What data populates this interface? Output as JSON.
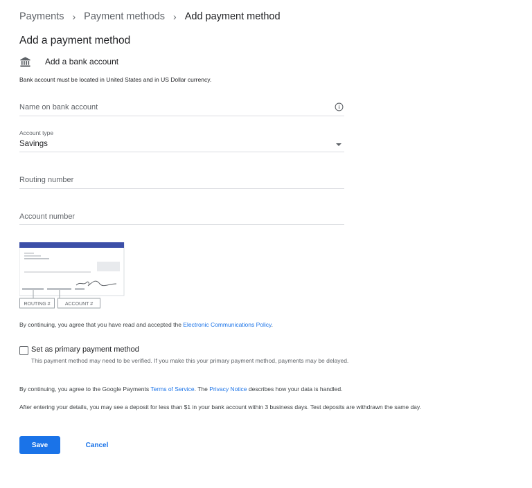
{
  "breadcrumb": {
    "items": [
      "Payments",
      "Payment methods",
      "Add payment method"
    ],
    "separator": "›"
  },
  "page_title": "Add a payment method",
  "section": {
    "icon": "bank-icon",
    "label": "Add a bank account"
  },
  "note": "Bank account must be located in United States and in US Dollar currency.",
  "fields": {
    "name": {
      "placeholder": "Name on bank account",
      "icon": "info-icon"
    },
    "account_type": {
      "label": "Account type",
      "value": "Savings",
      "icon": "dropdown-arrow-icon"
    },
    "routing": {
      "placeholder": "Routing number"
    },
    "account": {
      "placeholder": "Account number"
    }
  },
  "check": {
    "routing_label": "ROUTING #",
    "account_label": "ACCOUNT #"
  },
  "consent1": {
    "text": "By continuing, you agree that you have read and accepted the ",
    "link": "Electronic Communications Policy",
    "end": "."
  },
  "primary": {
    "label": "Set as primary payment method",
    "description": "This payment method may need to be verified. If you make this your primary payment method, payments may be delayed.",
    "checked": false
  },
  "consent2": {
    "text_before": "By continuing, you agree to the Google Payments ",
    "tos_link": "Terms of Service",
    "text_middle": ". The ",
    "privacy_link": "Privacy Notice",
    "text_after": " describes how your data is handled."
  },
  "deposit_note": "After entering your details, you may see a deposit for less than $1 in your bank account within 3 business days. Test deposits are withdrawn the same day.",
  "actions": {
    "save": "Save",
    "cancel": "Cancel"
  },
  "colors": {
    "accent": "#1a73e8",
    "check_header": "#3c4fa8"
  }
}
